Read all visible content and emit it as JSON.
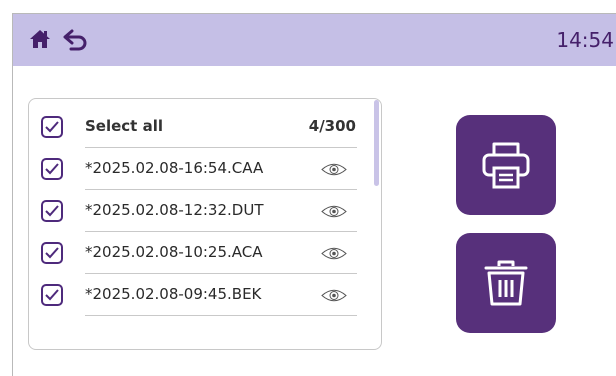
{
  "topbar": {
    "home_icon": "home-icon",
    "back_icon": "back-arrow-icon",
    "time": "14:54",
    "background": "#c5bfe6",
    "accent": "#45206a"
  },
  "file_list": {
    "select_all_label": "Select all",
    "count": "4/300",
    "items": [
      {
        "name": "*2025.02.08-16:54.CAA",
        "checked": true,
        "icon": "eye-icon"
      },
      {
        "name": "*2025.02.08-12:32.DUT",
        "checked": true,
        "icon": "eye-icon"
      },
      {
        "name": "*2025.02.08-10:25.ACA",
        "checked": true,
        "icon": "eye-icon"
      },
      {
        "name": "*2025.02.08-09:45.BEK",
        "checked": true,
        "icon": "eye-icon"
      }
    ]
  },
  "actions": {
    "print_icon": "printer-icon",
    "delete_icon": "trash-icon",
    "button_color": "#57307b"
  }
}
